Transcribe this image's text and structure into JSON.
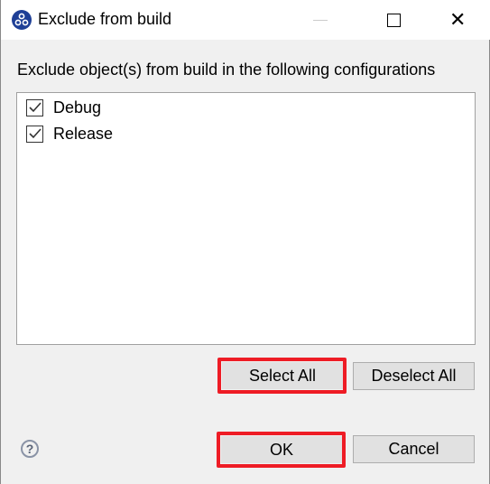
{
  "window": {
    "title": "Exclude from build",
    "icon": "app-logo-icon"
  },
  "dialog": {
    "prompt": "Exclude object(s) from build in the following configurations",
    "configurations": [
      {
        "label": "Debug",
        "checked": true
      },
      {
        "label": "Release",
        "checked": true
      }
    ],
    "select_all": "Select All",
    "deselect_all": "Deselect All",
    "ok": "OK",
    "cancel": "Cancel",
    "help": "?"
  },
  "colors": {
    "highlight": "#ee1c25",
    "app_icon": "#1e3f96"
  }
}
